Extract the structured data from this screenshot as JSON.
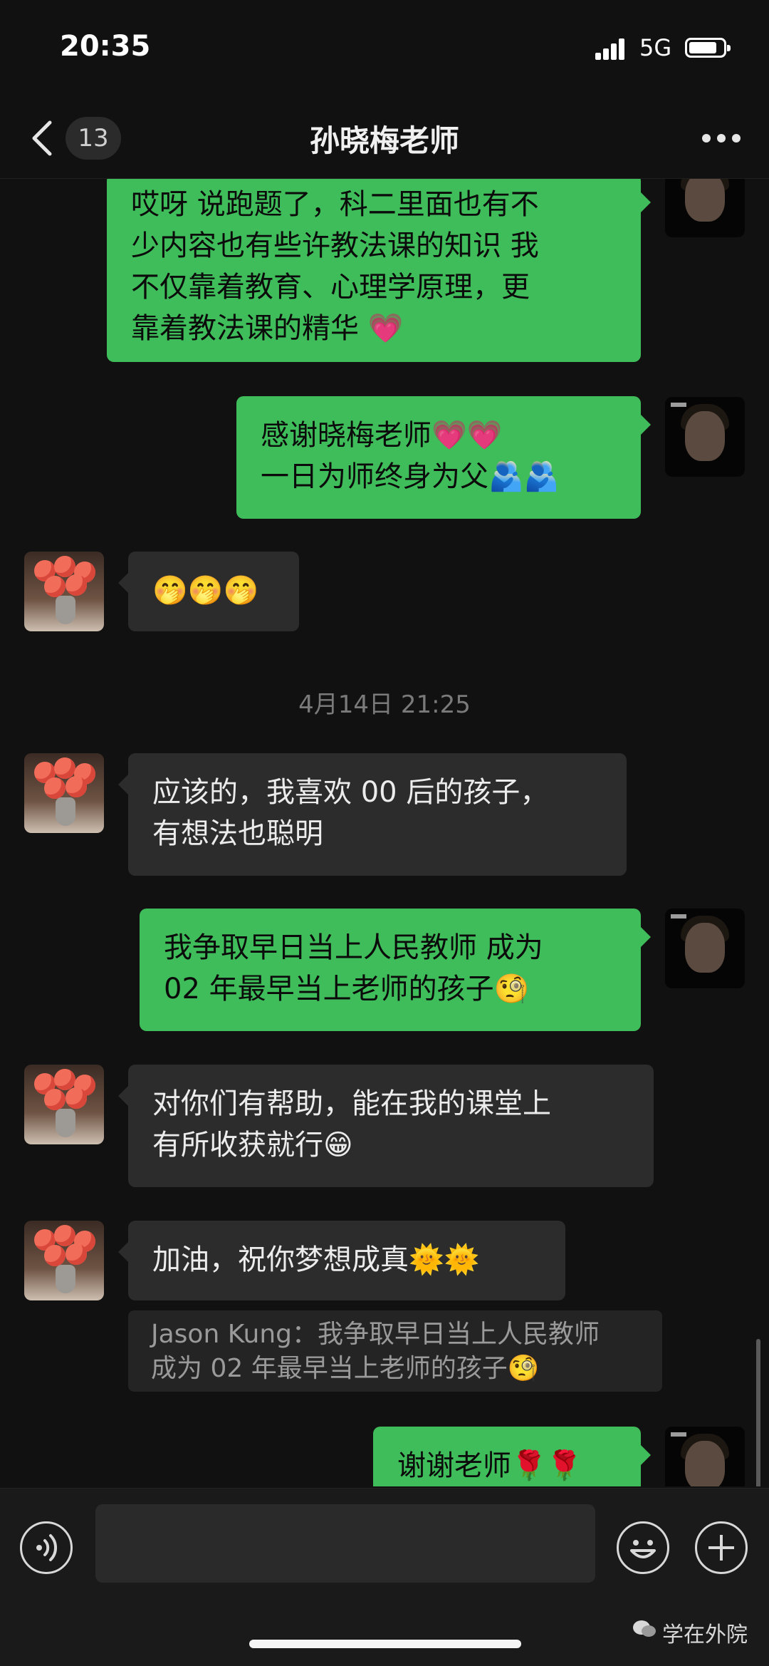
{
  "status_bar": {
    "time": "20:35",
    "network": "5G"
  },
  "nav": {
    "unread_count": "13",
    "title": "孙晓梅老师"
  },
  "messages": [
    {
      "side": "out",
      "lines": [
        "哎呀 说跑题了，科二里面也有不",
        "少内容也有些许教法课的知识 我",
        "不仅靠着教育、心理学原理，更",
        "靠着教法课的精华 💗"
      ]
    },
    {
      "side": "out",
      "lines": [
        "感谢晓梅老师💗💗",
        "一日为师终身为父🫂🫂"
      ]
    },
    {
      "side": "in",
      "lines": [
        "🤭🤭🤭"
      ]
    },
    {
      "side": "in",
      "lines": [
        "应该的，我喜欢 00 后的孩子，",
        "有想法也聪明"
      ]
    },
    {
      "side": "out",
      "lines": [
        "我争取早日当上人民教师 成为",
        "02 年最早当上老师的孩子🧐"
      ]
    },
    {
      "side": "in",
      "lines": [
        "对你们有帮助，能在我的课堂上",
        "有所收获就行😁"
      ]
    },
    {
      "side": "in",
      "lines": [
        "加油，祝你梦想成真🌞🌞"
      ]
    },
    {
      "side": "out",
      "lines": [
        "谢谢老师🌹🌹"
      ]
    }
  ],
  "timestamp": "4月14日 21:25",
  "quote": {
    "lines": [
      "Jason Kung：我争取早日当上人民教师",
      " 成为 02 年最早当上老师的孩子🧐"
    ]
  },
  "watermark": "学在外院",
  "colors": {
    "outgoing_bubble": "#3fbd5a",
    "incoming_bubble": "#2c2c2c",
    "background": "#111111"
  },
  "icons": [
    "back-arrow-icon",
    "more-dots-icon",
    "voice-icon",
    "emoji-icon",
    "plus-icon",
    "wechat-icon"
  ]
}
